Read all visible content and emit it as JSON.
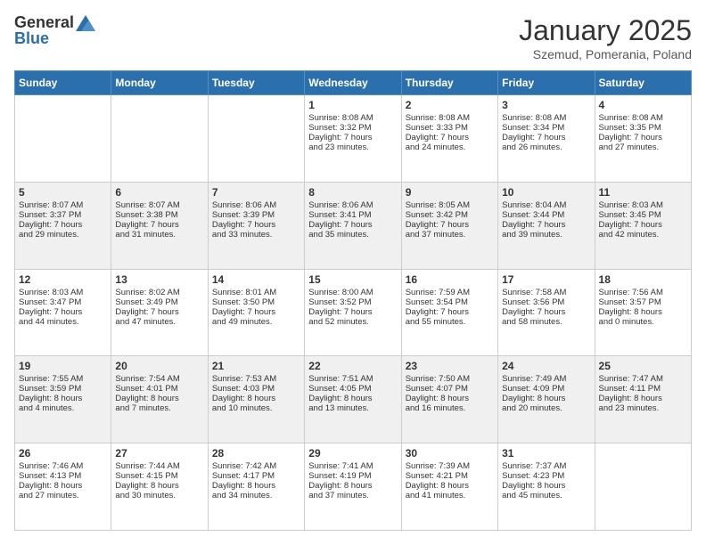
{
  "header": {
    "logo": {
      "text_general": "General",
      "text_blue": "Blue"
    },
    "title": "January 2025",
    "location": "Szemud, Pomerania, Poland"
  },
  "weekdays": [
    "Sunday",
    "Monday",
    "Tuesday",
    "Wednesday",
    "Thursday",
    "Friday",
    "Saturday"
  ],
  "weeks": [
    [
      {
        "day": "",
        "info": ""
      },
      {
        "day": "",
        "info": ""
      },
      {
        "day": "",
        "info": ""
      },
      {
        "day": "1",
        "info": "Sunrise: 8:08 AM\nSunset: 3:32 PM\nDaylight: 7 hours\nand 23 minutes."
      },
      {
        "day": "2",
        "info": "Sunrise: 8:08 AM\nSunset: 3:33 PM\nDaylight: 7 hours\nand 24 minutes."
      },
      {
        "day": "3",
        "info": "Sunrise: 8:08 AM\nSunset: 3:34 PM\nDaylight: 7 hours\nand 26 minutes."
      },
      {
        "day": "4",
        "info": "Sunrise: 8:08 AM\nSunset: 3:35 PM\nDaylight: 7 hours\nand 27 minutes."
      }
    ],
    [
      {
        "day": "5",
        "info": "Sunrise: 8:07 AM\nSunset: 3:37 PM\nDaylight: 7 hours\nand 29 minutes."
      },
      {
        "day": "6",
        "info": "Sunrise: 8:07 AM\nSunset: 3:38 PM\nDaylight: 7 hours\nand 31 minutes."
      },
      {
        "day": "7",
        "info": "Sunrise: 8:06 AM\nSunset: 3:39 PM\nDaylight: 7 hours\nand 33 minutes."
      },
      {
        "day": "8",
        "info": "Sunrise: 8:06 AM\nSunset: 3:41 PM\nDaylight: 7 hours\nand 35 minutes."
      },
      {
        "day": "9",
        "info": "Sunrise: 8:05 AM\nSunset: 3:42 PM\nDaylight: 7 hours\nand 37 minutes."
      },
      {
        "day": "10",
        "info": "Sunrise: 8:04 AM\nSunset: 3:44 PM\nDaylight: 7 hours\nand 39 minutes."
      },
      {
        "day": "11",
        "info": "Sunrise: 8:03 AM\nSunset: 3:45 PM\nDaylight: 7 hours\nand 42 minutes."
      }
    ],
    [
      {
        "day": "12",
        "info": "Sunrise: 8:03 AM\nSunset: 3:47 PM\nDaylight: 7 hours\nand 44 minutes."
      },
      {
        "day": "13",
        "info": "Sunrise: 8:02 AM\nSunset: 3:49 PM\nDaylight: 7 hours\nand 47 minutes."
      },
      {
        "day": "14",
        "info": "Sunrise: 8:01 AM\nSunset: 3:50 PM\nDaylight: 7 hours\nand 49 minutes."
      },
      {
        "day": "15",
        "info": "Sunrise: 8:00 AM\nSunset: 3:52 PM\nDaylight: 7 hours\nand 52 minutes."
      },
      {
        "day": "16",
        "info": "Sunrise: 7:59 AM\nSunset: 3:54 PM\nDaylight: 7 hours\nand 55 minutes."
      },
      {
        "day": "17",
        "info": "Sunrise: 7:58 AM\nSunset: 3:56 PM\nDaylight: 7 hours\nand 58 minutes."
      },
      {
        "day": "18",
        "info": "Sunrise: 7:56 AM\nSunset: 3:57 PM\nDaylight: 8 hours\nand 0 minutes."
      }
    ],
    [
      {
        "day": "19",
        "info": "Sunrise: 7:55 AM\nSunset: 3:59 PM\nDaylight: 8 hours\nand 4 minutes."
      },
      {
        "day": "20",
        "info": "Sunrise: 7:54 AM\nSunset: 4:01 PM\nDaylight: 8 hours\nand 7 minutes."
      },
      {
        "day": "21",
        "info": "Sunrise: 7:53 AM\nSunset: 4:03 PM\nDaylight: 8 hours\nand 10 minutes."
      },
      {
        "day": "22",
        "info": "Sunrise: 7:51 AM\nSunset: 4:05 PM\nDaylight: 8 hours\nand 13 minutes."
      },
      {
        "day": "23",
        "info": "Sunrise: 7:50 AM\nSunset: 4:07 PM\nDaylight: 8 hours\nand 16 minutes."
      },
      {
        "day": "24",
        "info": "Sunrise: 7:49 AM\nSunset: 4:09 PM\nDaylight: 8 hours\nand 20 minutes."
      },
      {
        "day": "25",
        "info": "Sunrise: 7:47 AM\nSunset: 4:11 PM\nDaylight: 8 hours\nand 23 minutes."
      }
    ],
    [
      {
        "day": "26",
        "info": "Sunrise: 7:46 AM\nSunset: 4:13 PM\nDaylight: 8 hours\nand 27 minutes."
      },
      {
        "day": "27",
        "info": "Sunrise: 7:44 AM\nSunset: 4:15 PM\nDaylight: 8 hours\nand 30 minutes."
      },
      {
        "day": "28",
        "info": "Sunrise: 7:42 AM\nSunset: 4:17 PM\nDaylight: 8 hours\nand 34 minutes."
      },
      {
        "day": "29",
        "info": "Sunrise: 7:41 AM\nSunset: 4:19 PM\nDaylight: 8 hours\nand 37 minutes."
      },
      {
        "day": "30",
        "info": "Sunrise: 7:39 AM\nSunset: 4:21 PM\nDaylight: 8 hours\nand 41 minutes."
      },
      {
        "day": "31",
        "info": "Sunrise: 7:37 AM\nSunset: 4:23 PM\nDaylight: 8 hours\nand 45 minutes."
      },
      {
        "day": "",
        "info": ""
      }
    ]
  ]
}
